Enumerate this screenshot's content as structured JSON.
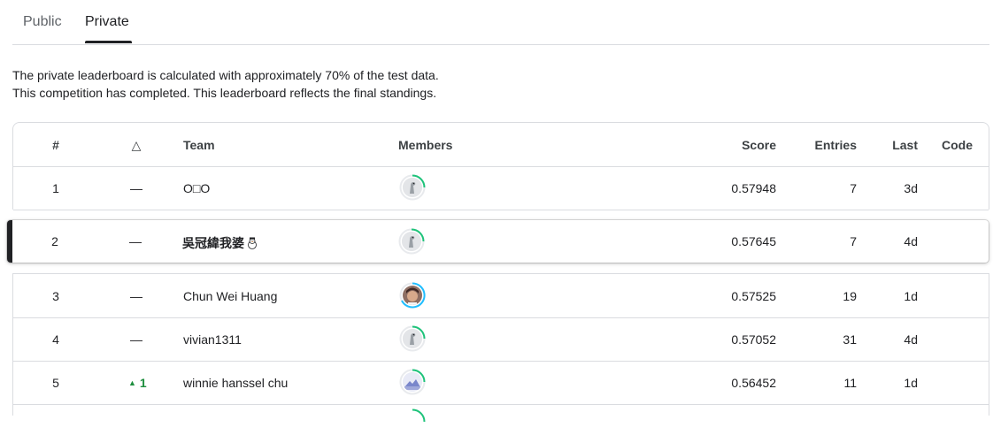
{
  "tabs": {
    "public": "Public",
    "private": "Private"
  },
  "notes": {
    "line1": "The private leaderboard is calculated with approximately 70% of the test data.",
    "line2": "This competition has completed. This leaderboard reflects the final standings."
  },
  "header": {
    "rank": "#",
    "delta": "△",
    "team": "Team",
    "members": "Members",
    "score": "Score",
    "entries": "Entries",
    "last": "Last",
    "code": "Code"
  },
  "rows": [
    {
      "rank": "1",
      "delta": "—",
      "team": "O□O",
      "avatar": "duck-avatar",
      "score": "0.57948",
      "entries": "7",
      "last": "3d"
    },
    {
      "rank": "2",
      "delta": "—",
      "team": "吳冠緯我婆",
      "avatar": "duck-avatar",
      "score": "0.57645",
      "entries": "7",
      "last": "4d"
    },
    {
      "rank": "3",
      "delta": "—",
      "team": "Chun Wei Huang",
      "avatar": "photo-avatar",
      "score": "0.57525",
      "entries": "19",
      "last": "1d"
    },
    {
      "rank": "4",
      "delta": "—",
      "team": "vivian1311",
      "avatar": "duck-avatar",
      "score": "0.57052",
      "entries": "31",
      "last": "4d"
    },
    {
      "rank": "5",
      "delta": "1",
      "delta_dir": "up",
      "team": "winnie hanssel chu",
      "avatar": "landscape-avatar",
      "score": "0.56452",
      "entries": "11",
      "last": "1d"
    }
  ],
  "colors": {
    "accent_green": "#1e8e3e",
    "ring_green": "#20beff",
    "border": "#dadce0"
  }
}
